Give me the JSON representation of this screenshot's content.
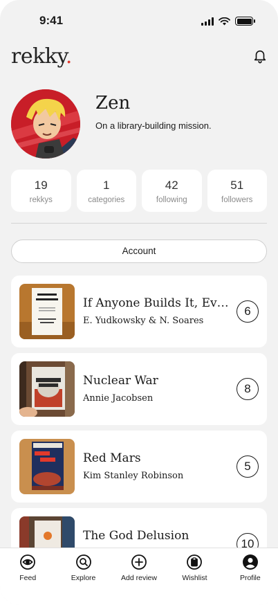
{
  "status_bar": {
    "time": "9:41"
  },
  "header": {
    "logo_text": "rekky",
    "logo_dot": ".",
    "accent": "#e03a2f"
  },
  "profile": {
    "name": "Zen",
    "bio": "On a library-building mission."
  },
  "stats": [
    {
      "value": "19",
      "label": "rekkys"
    },
    {
      "value": "1",
      "label": "categories"
    },
    {
      "value": "42",
      "label": "following"
    },
    {
      "value": "51",
      "label": "followers"
    }
  ],
  "account_button": "Account",
  "books": [
    {
      "title": "If Anyone Builds It, Eve...",
      "author": "E. Yudkowsky & N. Soares",
      "score": "6"
    },
    {
      "title": "Nuclear War",
      "author": "Annie Jacobsen",
      "score": "8"
    },
    {
      "title": "Red Mars",
      "author": "Kim Stanley Robinson",
      "score": "5"
    },
    {
      "title": "The God Delusion",
      "author": "",
      "score": "10"
    }
  ],
  "tabbar": [
    {
      "label": "Feed",
      "icon": "eye-icon"
    },
    {
      "label": "Explore",
      "icon": "search-icon"
    },
    {
      "label": "Add review",
      "icon": "plus-circle-icon"
    },
    {
      "label": "Wishlist",
      "icon": "clipboard-icon"
    },
    {
      "label": "Profile",
      "icon": "user-icon"
    }
  ]
}
